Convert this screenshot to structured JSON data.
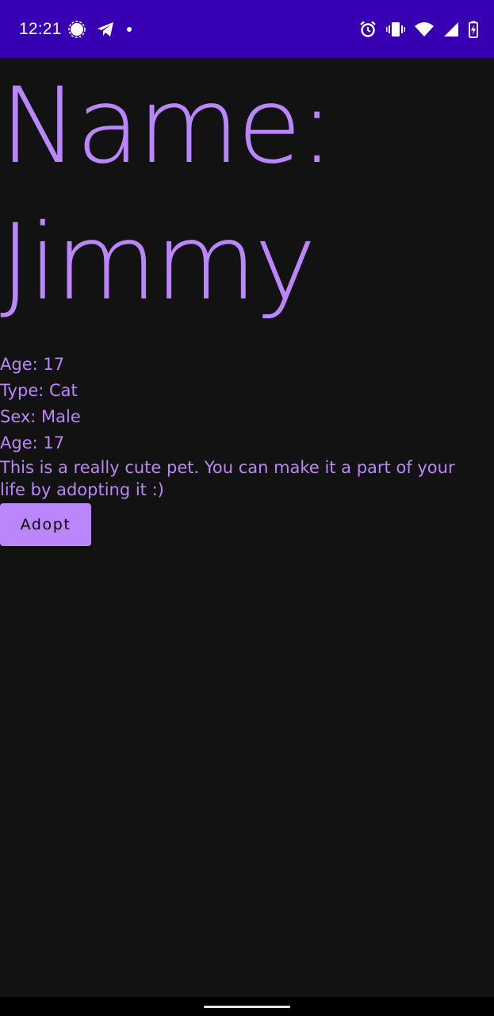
{
  "status_bar": {
    "time": "12:21",
    "background_color": "#3700B3",
    "left_icons": [
      "signal-messenger-icon",
      "telegram-icon",
      "notification-dot-icon"
    ],
    "right_icons": [
      "alarm-icon",
      "vibrate-icon",
      "wifi-icon",
      "cell-signal-icon",
      "battery-charging-icon"
    ]
  },
  "pet": {
    "name_line": "Name: Jimmy",
    "age_line": "Age: 17",
    "type_line": "Type: Cat",
    "sex_line": "Sex: Male",
    "age_line_2": "Age: 17",
    "description": "This is a really cute pet. You can make it a part of your life by adopting it :)"
  },
  "actions": {
    "adopt_label": "Adopt"
  },
  "theme": {
    "background": "#121212",
    "accent": "#BB86FC",
    "button_text": "#000000"
  }
}
